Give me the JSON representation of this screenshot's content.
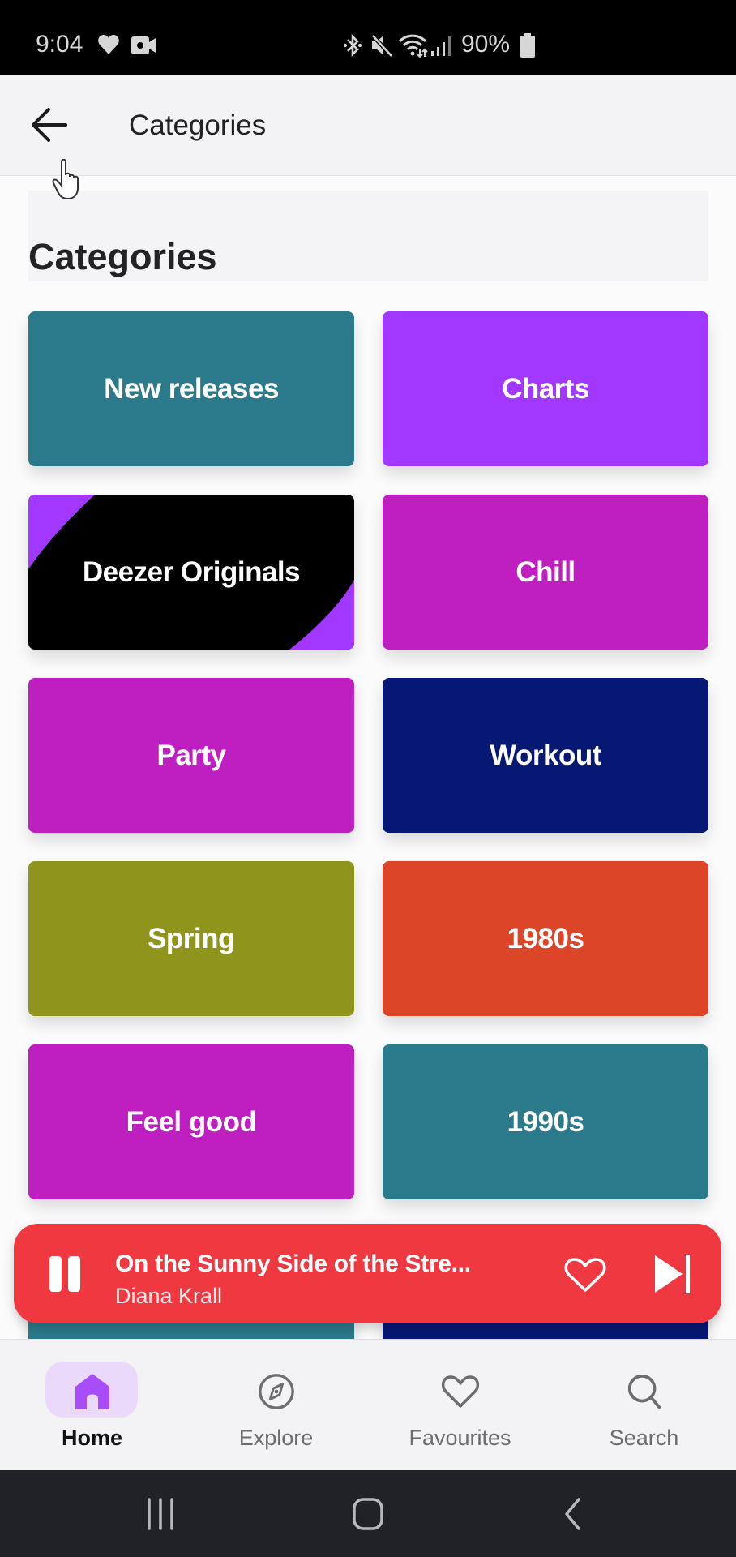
{
  "status_bar": {
    "time": "9:04",
    "battery": "90%",
    "left_icons": [
      "health-heart-icon",
      "video-record-icon"
    ],
    "right_icons": [
      "bluetooth-icon",
      "mute-icon",
      "wifi-icon",
      "signal-icon",
      "battery-icon"
    ]
  },
  "app_bar": {
    "back_icon": "arrow-left-icon",
    "title": "Categories"
  },
  "section": {
    "title": "Categories"
  },
  "colors": {
    "teal": "#2b7a8b",
    "purple": "#a238ff",
    "magenta": "#bf1fc1",
    "navy": "#061774",
    "olive": "#8f951c",
    "orange": "#dc4527",
    "black": "#000000",
    "player_red": "#ef3840",
    "nav_active_pill": "#ead9fb",
    "nav_active_icon": "#a94dfa"
  },
  "categories": [
    {
      "label": "New releases",
      "color": "#2b7a8b"
    },
    {
      "label": "Charts",
      "color": "#a238ff"
    },
    {
      "label": "Deezer Originals",
      "color": "#000000",
      "accent": "#a238ff"
    },
    {
      "label": "Chill",
      "color": "#bf1fc1"
    },
    {
      "label": "Party",
      "color": "#bf1fc1"
    },
    {
      "label": "Workout",
      "color": "#061774"
    },
    {
      "label": "Spring",
      "color": "#8f951c"
    },
    {
      "label": "1980s",
      "color": "#dc4527"
    },
    {
      "label": "Feel good",
      "color": "#bf1fc1"
    },
    {
      "label": "1990s",
      "color": "#2b7a8b"
    },
    {
      "label": "",
      "color": "#2b7a8b"
    },
    {
      "label": "",
      "color": "#061774"
    }
  ],
  "mini_player": {
    "title": "On the Sunny Side of the Stre...",
    "artist": "Diana Krall",
    "state": "playing",
    "favourited": false
  },
  "bottom_nav": {
    "items": [
      {
        "label": "Home",
        "icon": "home-icon",
        "active": true
      },
      {
        "label": "Explore",
        "icon": "compass-icon",
        "active": false
      },
      {
        "label": "Favourites",
        "icon": "heart-icon",
        "active": false
      },
      {
        "label": "Search",
        "icon": "search-icon",
        "active": false
      }
    ]
  },
  "system_nav": [
    "recent-apps-icon",
    "home-button-icon",
    "back-icon"
  ]
}
